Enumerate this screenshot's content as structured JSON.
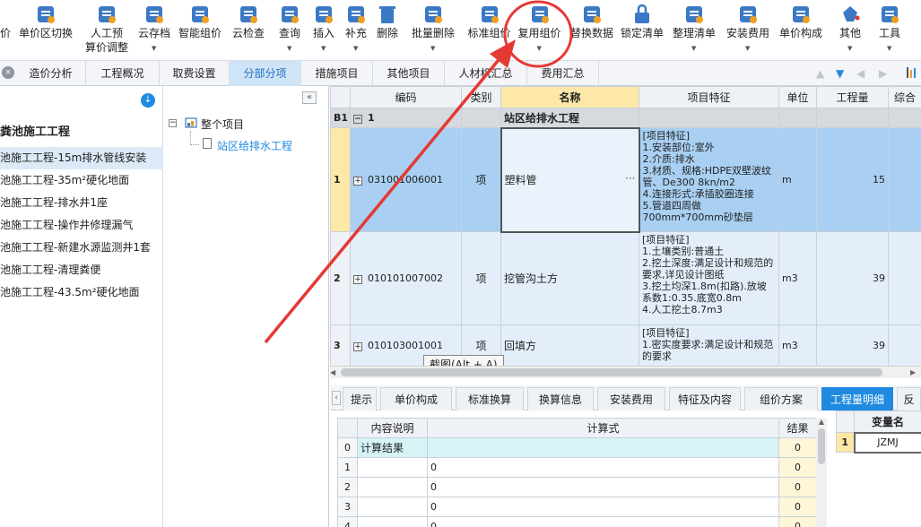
{
  "toolbar": {
    "items": [
      {
        "label": "价",
        "sub": "",
        "icon": "price-icon"
      },
      {
        "label": "单价区切换",
        "sub": "",
        "icon": "switch-icon"
      },
      {
        "label": "人工预",
        "sub": "算价调整",
        "icon": "user-adjust-icon"
      },
      {
        "label": "云存档",
        "sub": "",
        "icon": "cloud-upload-icon"
      },
      {
        "label": "智能组价",
        "sub": "",
        "icon": "smart-price-icon"
      },
      {
        "label": "云检查",
        "sub": "",
        "icon": "cloud-check-icon"
      },
      {
        "label": "查询",
        "sub": "",
        "icon": "query-icon"
      },
      {
        "label": "插入",
        "sub": "",
        "icon": "insert-icon"
      },
      {
        "label": "补充",
        "sub": "",
        "icon": "supplement-icon"
      },
      {
        "label": "删除",
        "sub": "",
        "icon": "trash-icon"
      },
      {
        "label": "批量删除",
        "sub": "",
        "icon": "batch-delete-icon"
      },
      {
        "label": "标准组价",
        "sub": "",
        "icon": "standard-price-icon"
      },
      {
        "label": "复用组价",
        "sub": "",
        "icon": "reuse-price-icon"
      },
      {
        "label": "替换数据",
        "sub": "",
        "icon": "replace-data-icon"
      },
      {
        "label": "锁定清单",
        "sub": "",
        "icon": "lock-icon"
      },
      {
        "label": "整理清单",
        "sub": "",
        "icon": "organize-list-icon"
      },
      {
        "label": "安装费用",
        "sub": "",
        "icon": "install-fee-icon"
      },
      {
        "label": "单价构成",
        "sub": "",
        "icon": "unit-price-icon"
      },
      {
        "label": "其他",
        "sub": "",
        "icon": "bucket-icon"
      },
      {
        "label": "工具",
        "sub": "",
        "icon": "tools-icon"
      }
    ]
  },
  "tabs": [
    "造价分析",
    "工程概况",
    "取费设置",
    "分部分项",
    "措施项目",
    "其他项目",
    "人材机汇总",
    "费用汇总"
  ],
  "active_tab": "分部分项",
  "left": {
    "title": "粪池施工工程",
    "items": [
      "池施工工程-15m排水管线安装",
      "池施工工程-35m²硬化地面",
      "池施工工程-排水井1座",
      "池施工工程-操作井修理漏气",
      "池施工工程-新建水源监测井1套",
      "池施工工程-清理粪便",
      "池施工工程-43.5m²硬化地面"
    ]
  },
  "tree": {
    "root": "整个项目",
    "child": "站区给排水工程",
    "collapse_label": "«"
  },
  "grid": {
    "headers": [
      "",
      "编码",
      "类别",
      "名称",
      "项目特征",
      "单位",
      "工程量",
      "综合"
    ],
    "section": {
      "no": "B1",
      "code": "1",
      "name": "站区给排水工程"
    },
    "rows": [
      {
        "no": "1",
        "code": "031001006001",
        "type": "项",
        "name": "塑料管",
        "feature": "[项目特征]\n1.安装部位:室外\n2.介质:排水\n3.材质、规格:HDPE双壁波纹管、De300 8kn/m2\n4.连接形式:承插胶圈连接\n5.管道四周做700mm*700mm砂垫层",
        "unit": "m",
        "qty": "15"
      },
      {
        "no": "2",
        "code": "010101007002",
        "type": "项",
        "name": "挖管沟土方",
        "feature": "[项目特征]\n1.土壤类别:普通土\n2.挖土深度:满足设计和规范的要求,详见设计图纸\n3.挖土均深1.8m(扣路).放坡系数1:0.35.底宽0.8m\n4.人工挖土8.7m3",
        "unit": "m3",
        "qty": "39"
      },
      {
        "no": "3",
        "code": "010103001001",
        "type": "项",
        "name": "回填方",
        "feature": "[项目特征]\n1.密实度要求:满足设计和规范的要求",
        "unit": "m3",
        "qty": "39"
      }
    ]
  },
  "tooltip": "截图(Alt + A)",
  "bottom_tabs": [
    "提示",
    "单价构成",
    "标准换算",
    "换算信息",
    "安装费用",
    "特征及内容",
    "组价方案",
    "工程量明细",
    "反"
  ],
  "active_bottom_tab": "工程量明细",
  "calc": {
    "headers": [
      "",
      "内容说明",
      "计算式",
      "结果"
    ],
    "rows": [
      {
        "no": "0",
        "desc": "计算结果",
        "formula": "",
        "result": "0"
      },
      {
        "no": "1",
        "desc": "",
        "formula": "0",
        "result": "0"
      },
      {
        "no": "2",
        "desc": "",
        "formula": "0",
        "result": "0"
      },
      {
        "no": "3",
        "desc": "",
        "formula": "0",
        "result": "0"
      },
      {
        "no": "4",
        "desc": "",
        "formula": "0",
        "result": "0"
      }
    ]
  },
  "vars": {
    "header": "变量名",
    "rows": [
      {
        "no": "1",
        "name": "JZMJ"
      }
    ]
  },
  "colors": {
    "accent": "#1f8ae0",
    "selected_row": "#a9d0f2",
    "annotation": "#e53935"
  }
}
